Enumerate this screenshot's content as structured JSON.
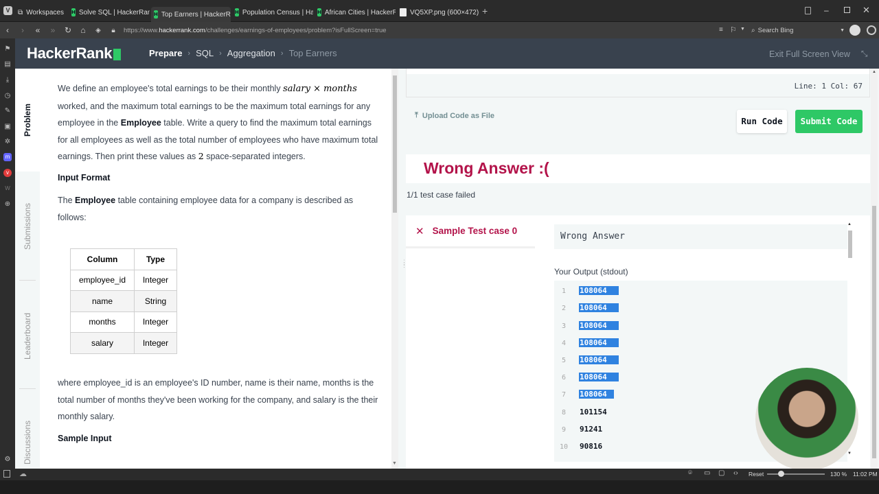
{
  "browser": {
    "workspaces_label": "Workspaces",
    "tabs": [
      {
        "label": "Solve SQL | HackerRank"
      },
      {
        "label": "Top Earners | HackerRank"
      },
      {
        "label": "Population Census | Hacke"
      },
      {
        "label": "African Cities | HackerRank"
      },
      {
        "label": "VQ5XP.png (600×472)"
      }
    ],
    "url_prefix": "https://www.",
    "url_domain": "hackerrank.com",
    "url_path": "/challenges/earnings-of-employees/problem?isFullScreen=true",
    "search_placeholder": "Search Bing"
  },
  "header": {
    "logo": "HackerRank",
    "breadcrumb": [
      "Prepare",
      "SQL",
      "Aggregation",
      "Top Earners"
    ],
    "exit_fullscreen": "Exit Full Screen View"
  },
  "side_tabs": [
    "Problem",
    "Submissions",
    "Leaderboard",
    "Discussions"
  ],
  "problem": {
    "p1_a": "We define an employee's total earnings to be their monthly",
    "p1_math": "salary × months",
    "p1_b": "worked, and the maximum total earnings to be the maximum total earnings for any employee in the",
    "p1_bold": "Employee",
    "p1_c": "table. Write a query to find the maximum total earnings for all employees as well as the total number of employees who have maximum total earnings. Then print these values as",
    "p1_num": "2",
    "p1_d": "space-separated integers.",
    "input_format": "Input Format",
    "p2_a": "The",
    "p2_bold": "Employee",
    "p2_b": "table containing employee data for a company is described as follows:",
    "table": {
      "headers": [
        "Column",
        "Type"
      ],
      "rows": [
        [
          "employee_id",
          "Integer"
        ],
        [
          "name",
          "String"
        ],
        [
          "months",
          "Integer"
        ],
        [
          "salary",
          "Integer"
        ]
      ]
    },
    "p3": "where employee_id is an employee's ID number, name is their name, months is the total number of months they've been working for the company, and salary is the their monthly salary.",
    "sample_input": "Sample Input"
  },
  "editor": {
    "line_col": "Line: 1 Col: 67",
    "upload": "Upload Code as File",
    "run": "Run Code",
    "submit": "Submit Code"
  },
  "result": {
    "title": "Wrong Answer :(",
    "summary": "1/1 test case failed",
    "testcase": "Sample Test case 0",
    "verdict": "Wrong Answer",
    "output_label": "Your Output (stdout)",
    "output_lines": [
      {
        "n": "1",
        "v": "108064"
      },
      {
        "n": "2",
        "v": "108064"
      },
      {
        "n": "3",
        "v": "108064"
      },
      {
        "n": "4",
        "v": "108064"
      },
      {
        "n": "5",
        "v": "108064"
      },
      {
        "n": "6",
        "v": "108064"
      },
      {
        "n": "7",
        "v": "108064"
      },
      {
        "n": "8",
        "v": "101154"
      },
      {
        "n": "9",
        "v": "91241"
      },
      {
        "n": "10",
        "v": "90816"
      }
    ]
  },
  "statusbar": {
    "reset": "Reset",
    "zoom": "130 %",
    "time": "11:02 PM"
  },
  "colors": {
    "header_bg": "#39424e",
    "brand_green": "#2ec866",
    "wrong_red": "#b3134a",
    "selection_blue": "#2f82e0"
  }
}
